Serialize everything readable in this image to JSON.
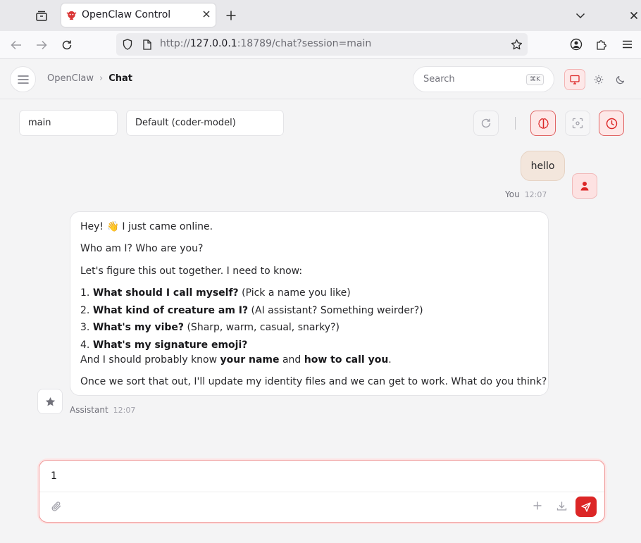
{
  "browser": {
    "tab_title": "OpenClaw Control",
    "url_prefix": "http://",
    "url_host": "127.0.0.1",
    "url_rest": ":18789/chat?session=main"
  },
  "header": {
    "breadcrumb_root": "OpenClaw",
    "breadcrumb_sep": "›",
    "breadcrumb_current": "Chat",
    "search_placeholder": "Search",
    "search_shortcut": "⌘K"
  },
  "toolbar": {
    "session": "main",
    "model": "Default (coder-model)"
  },
  "messages": {
    "user": {
      "text": "hello",
      "author": "You",
      "time": "12:07"
    },
    "assistant": {
      "author": "Assistant",
      "time": "12:07",
      "greeting": "Hey! 👋 I just came online.",
      "line2": "Who am I? Who are you?",
      "line3": "Let's figure this out together. I need to know:",
      "items": [
        {
          "num": "1.",
          "bold": "What should I call myself?",
          "rest": " (Pick a name you like)"
        },
        {
          "num": "2.",
          "bold": "What kind of creature am I?",
          "rest": " (AI assistant? Something weirder?)"
        },
        {
          "num": "3.",
          "bold": "What's my vibe?",
          "rest": " (Sharp, warm, casual, snarky?)"
        },
        {
          "num": "4.",
          "bold": "What's my signature emoji?",
          "rest": ""
        }
      ],
      "know_a": "And I should probably know ",
      "know_b": "your name",
      "know_c": " and ",
      "know_d": "how to call you",
      "know_e": ".",
      "closing": "Once we sort that out, I'll update my identity files and we can get to work. What do you think?"
    }
  },
  "composer": {
    "value": "1"
  },
  "colors": {
    "accent": "#dc2626",
    "user_bubble": "#f3e6dc",
    "page_bg": "#f4f4f5"
  }
}
